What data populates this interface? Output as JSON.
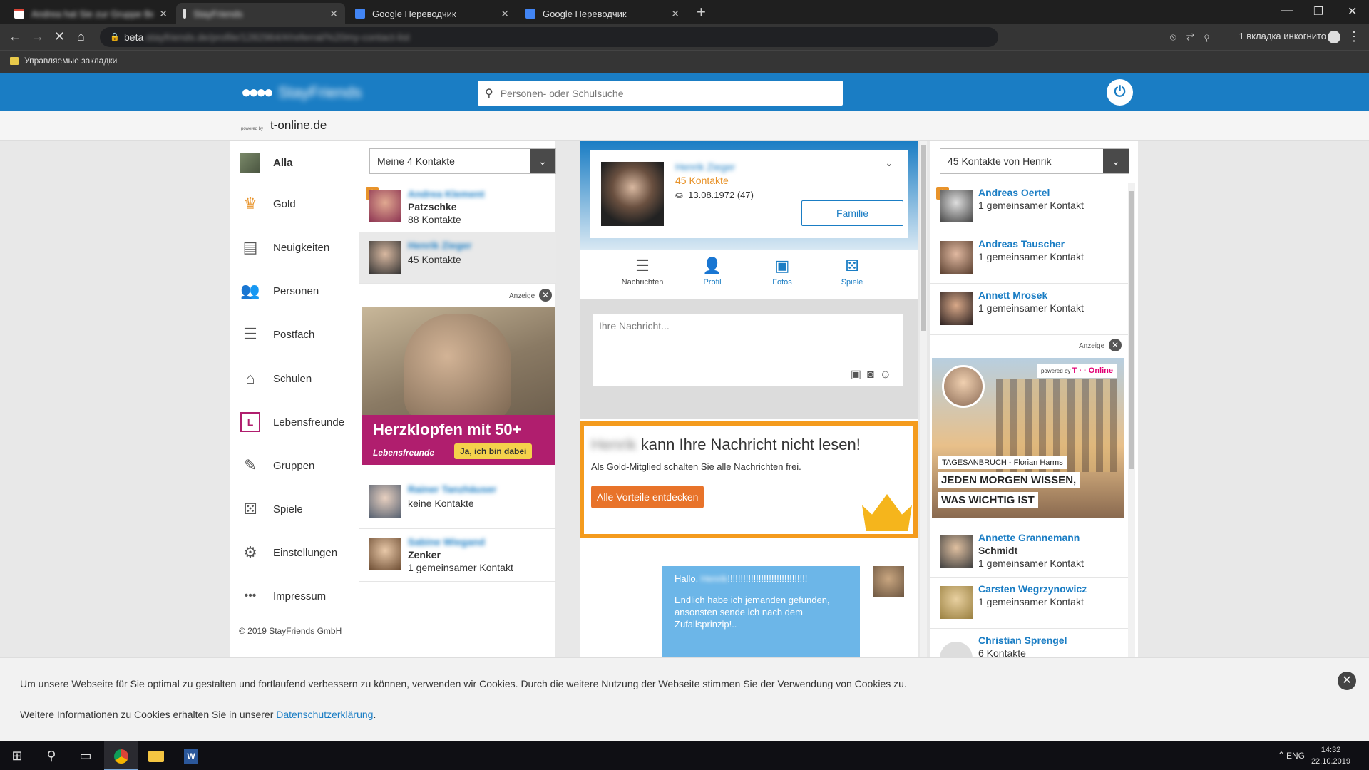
{
  "browser": {
    "tabs": [
      {
        "title": "Andrea hat Sie zur Gruppe Beto",
        "blurred": true
      },
      {
        "title": "StayFriends",
        "blurred": true
      },
      {
        "title": "Google Переводчик",
        "blurred": false
      },
      {
        "title": "Google Переводчик",
        "blurred": false
      }
    ],
    "url_prefix": "beta",
    "url_rest": ".stayfriends.de/profile/1282964/#/referral/%20my-contact-list",
    "incognito_label": "1 вкладка инкогнито",
    "bookmark_folder": "Управляемые закладки"
  },
  "site": {
    "logo_text": "StayFriends",
    "search_placeholder": "Personen- oder Schulsuche",
    "powered_by": "powered by",
    "partner": "t-online.de"
  },
  "left_nav": {
    "items": [
      {
        "label": "Alla",
        "icon": "avatar"
      },
      {
        "label": "Gold",
        "icon": "crown-icon"
      },
      {
        "label": "Neuigkeiten",
        "icon": "news-icon"
      },
      {
        "label": "Personen",
        "icon": "people-icon"
      },
      {
        "label": "Postfach",
        "icon": "chat-icon"
      },
      {
        "label": "Schulen",
        "icon": "school-icon"
      },
      {
        "label": "Lebensfreunde",
        "icon": "lebensfreunde-icon"
      },
      {
        "label": "Gruppen",
        "icon": "pin-icon"
      },
      {
        "label": "Spiele",
        "icon": "dice-icon"
      },
      {
        "label": "Einstellungen",
        "icon": "gear-icon"
      },
      {
        "label": "Impressum",
        "icon": "more-icon"
      }
    ],
    "copyright": "© 2019   StayFriends GmbH"
  },
  "contacts": {
    "dropdown": "Meine 4 Kontakte",
    "items": [
      {
        "name": "Andrea Klement",
        "line2": "Patzschke",
        "line3": "88 Kontakte"
      },
      {
        "name": "Henrik Zieger",
        "line2": "45 Kontakte"
      },
      {
        "name": "Rainer Tanzhäuser",
        "line2": "keine Kontakte"
      },
      {
        "name": "Sabine Wiegand",
        "line2": "Zenker",
        "line3": "1 gemeinsamer Kontakt"
      }
    ],
    "ad": {
      "label": "Anzeige",
      "headline": "Herzklopfen mit 50+",
      "brand": "Lebensfreunde",
      "cta": "Ja, ich bin dabei"
    }
  },
  "profile": {
    "name": "Henrik Zieger",
    "contacts": "45 Kontakte",
    "birthday": "13.08.1972 (47)",
    "relation_button": "Familie",
    "tabs": [
      {
        "label": "Nachrichten",
        "icon": "message-icon"
      },
      {
        "label": "Profil",
        "icon": "profile-icon"
      },
      {
        "label": "Fotos",
        "icon": "photos-icon"
      },
      {
        "label": "Spiele",
        "icon": "dice-icon"
      }
    ],
    "message_placeholder": "Ihre Nachricht...",
    "gold": {
      "name_blurred": "Henrik",
      "headline": "kann Ihre Nachricht nicht lesen!",
      "sub": "Als Gold-Mitglied schalten Sie alle Nachrichten frei.",
      "button": "Alle Vorteile entdecken"
    },
    "chat": {
      "greeting": "Hallo,",
      "greeting_name": "Henrik",
      "exclaim": "!!!!!!!!!!!!!!!!!!!!!!!!!!!!!!!",
      "body": "Endlich habe ich jemanden gefunden, ansonsten sende ich nach dem Zufallsprinzip!.."
    }
  },
  "right": {
    "dropdown": "45 Kontakte von Henrik",
    "items": [
      {
        "name": "Andreas Oertel",
        "line2": "1 gemeinsamer Kontakt"
      },
      {
        "name": "Andreas Tauscher",
        "line2": "1 gemeinsamer Kontakt"
      },
      {
        "name": "Annett Mrosek",
        "line2": "1 gemeinsamer Kontakt"
      },
      {
        "name": "Annette Grannemann",
        "line2": "Schmidt",
        "line3": "1 gemeinsamer Kontakt"
      },
      {
        "name": "Carsten Wegrzynowicz",
        "line2": "1 gemeinsamer Kontakt"
      },
      {
        "name": "Christian Sprengel",
        "line2": "6 Kontakte"
      }
    ],
    "ad": {
      "label": "Anzeige",
      "badge_small": "powered by",
      "badge_brand": "T · · Online",
      "line1": "TAGESANBRUCH - Florian Harms",
      "line2": "JEDEN MORGEN WISSEN,",
      "line3": "WAS WICHTIG IST"
    }
  },
  "cookie": {
    "text1": "Um unsere Webseite für Sie optimal zu gestalten und fortlaufend verbessern zu können, verwenden wir Cookies. Durch die weitere Nutzung der Webseite stimmen Sie der Verwendung von Cookies zu.",
    "text2": "Weitere Informationen zu Cookies erhalten Sie in unserer",
    "link": "Datenschutzerklärung",
    "text2_end": "."
  },
  "taskbar": {
    "lang": "ENG",
    "time": "14:32",
    "date": "22.10.2019"
  }
}
